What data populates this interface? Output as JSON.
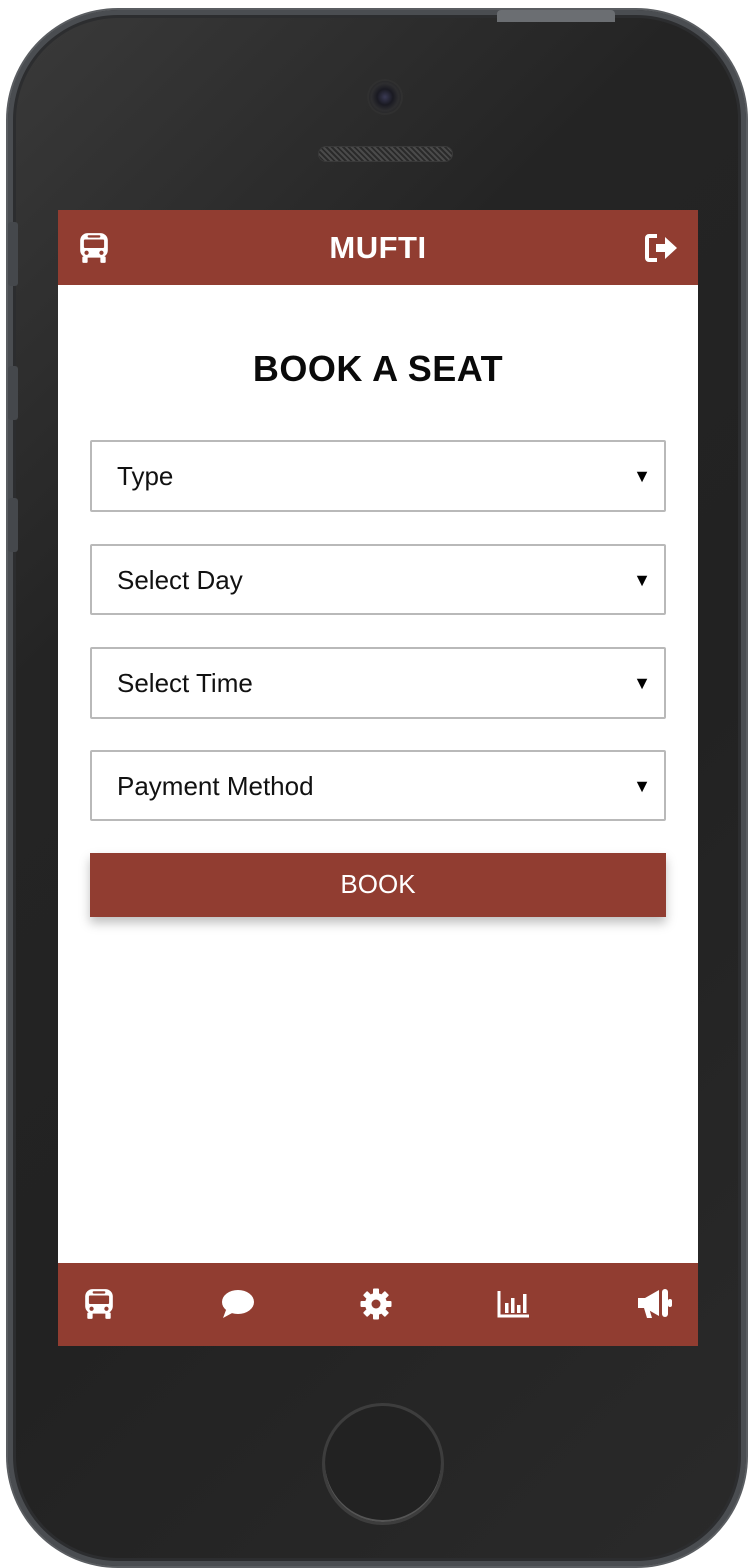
{
  "app": {
    "title": "MUFTI",
    "brand_color": "#913d31"
  },
  "header": {
    "left_icon": "bus-icon",
    "right_icon": "logout-icon"
  },
  "page": {
    "heading": "BOOK A SEAT"
  },
  "form": {
    "type": {
      "value": "Type"
    },
    "day": {
      "value": "Select Day"
    },
    "time": {
      "value": "Select Time"
    },
    "payment": {
      "value": "Payment Method"
    },
    "arrow": "▼",
    "book_label": "BOOK"
  },
  "bottom_nav": {
    "items": [
      {
        "icon": "bus-icon"
      },
      {
        "icon": "chat-icon"
      },
      {
        "icon": "gear-icon"
      },
      {
        "icon": "chart-icon"
      },
      {
        "icon": "megaphone-icon"
      }
    ]
  }
}
